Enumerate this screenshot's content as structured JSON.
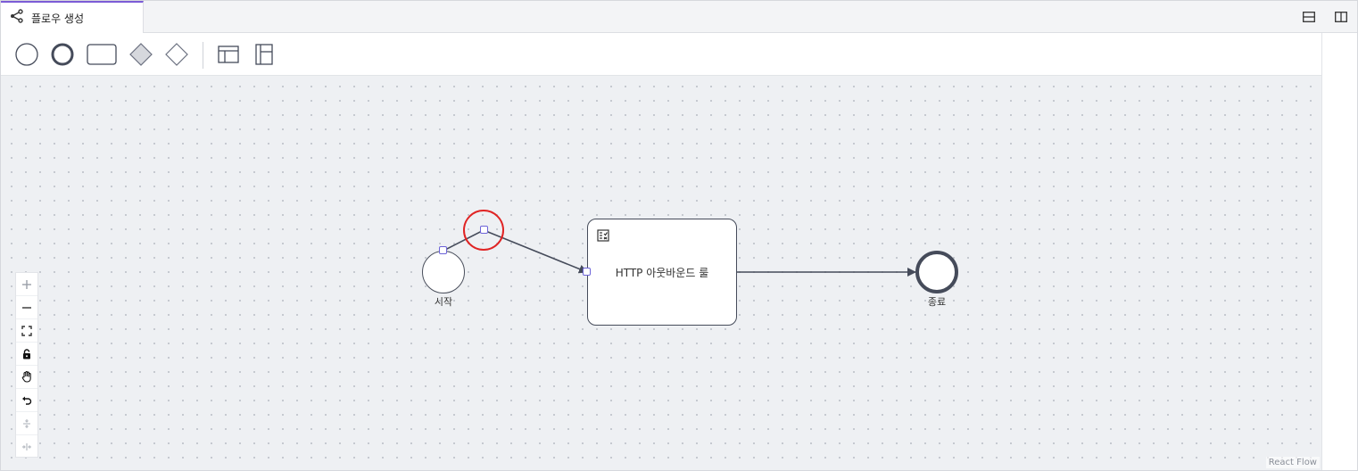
{
  "tab": {
    "title": "플로우 생성",
    "icon": "share-nodes-icon"
  },
  "tab_actions": [
    {
      "name": "split-horizontal-button",
      "icon": "split-horizontal-icon"
    },
    {
      "name": "split-vertical-button",
      "icon": "split-vertical-icon"
    }
  ],
  "toolbar": {
    "tools": [
      {
        "name": "start-event-tool",
        "icon": "thin-circle-icon"
      },
      {
        "name": "end-event-tool",
        "icon": "thick-circle-icon"
      },
      {
        "name": "task-tool",
        "icon": "rounded-rectangle-icon"
      },
      {
        "name": "gateway-filled-tool",
        "icon": "filled-diamond-icon"
      },
      {
        "name": "gateway-outline-tool",
        "icon": "outline-diamond-icon"
      },
      {
        "name": "table-horizontal-tool",
        "icon": "table-columns-icon"
      },
      {
        "name": "table-vertical-tool",
        "icon": "table-rows-icon"
      }
    ]
  },
  "flow": {
    "start_label": "시작",
    "task_label": "HTTP 아웃바운드 룰",
    "end_label": "종료"
  },
  "controls": [
    {
      "name": "zoom-in",
      "icon": "plus-icon"
    },
    {
      "name": "zoom-out",
      "icon": "minus-icon"
    },
    {
      "name": "fit-view",
      "icon": "fit-view-icon"
    },
    {
      "name": "lock",
      "icon": "lock-icon"
    },
    {
      "name": "pan",
      "icon": "hand-icon"
    },
    {
      "name": "undo",
      "icon": "undo-icon"
    },
    {
      "name": "align-vertical",
      "icon": "align-vertical-icon"
    },
    {
      "name": "align-horizontal",
      "icon": "align-horizontal-icon"
    }
  ],
  "attribution": "React Flow",
  "colors": {
    "accent": "#7b5bd6",
    "node_stroke": "#454b5a",
    "handle": "#6c63d8",
    "highlight": "#e02424",
    "canvas": "#eef0f3"
  }
}
